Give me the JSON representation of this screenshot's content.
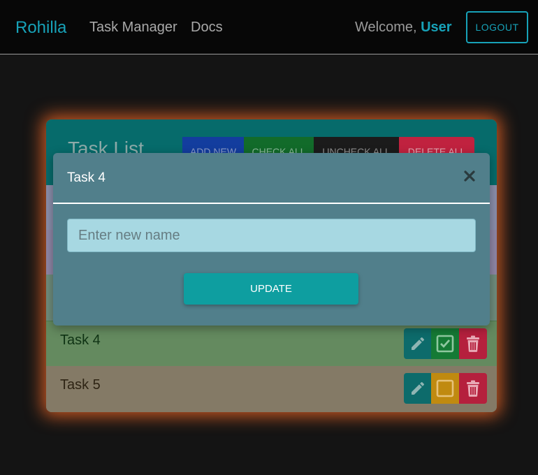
{
  "navbar": {
    "brand": "Rohilla",
    "links": [
      "Task Manager",
      "Docs"
    ],
    "welcome_prefix": "Welcome, ",
    "username": "User",
    "logout_label": "LOGOUT"
  },
  "task_list": {
    "title": "Task List",
    "header_buttons": {
      "add_new": "ADD NEW",
      "check_all": "CHECK ALL",
      "uncheck_all": "UNCHECK ALL",
      "delete_all": "DELETE ALL"
    },
    "tasks": [
      {
        "name": "Task 4",
        "completed": true
      },
      {
        "name": "Task 5",
        "completed": false
      }
    ]
  },
  "modal": {
    "title": "Task 4",
    "input_placeholder": "Enter new name",
    "input_value": "",
    "update_label": "UPDATE",
    "close_icon": "close-icon"
  },
  "colors": {
    "accent": "#17a2b8",
    "glow": "#ff6e28",
    "modal_bg": "#517f8b",
    "update_button": "#0e9ea0"
  },
  "icons": [
    "pencil-icon",
    "checkbox-checked-icon",
    "checkbox-empty-icon",
    "trash-icon",
    "close-icon"
  ]
}
